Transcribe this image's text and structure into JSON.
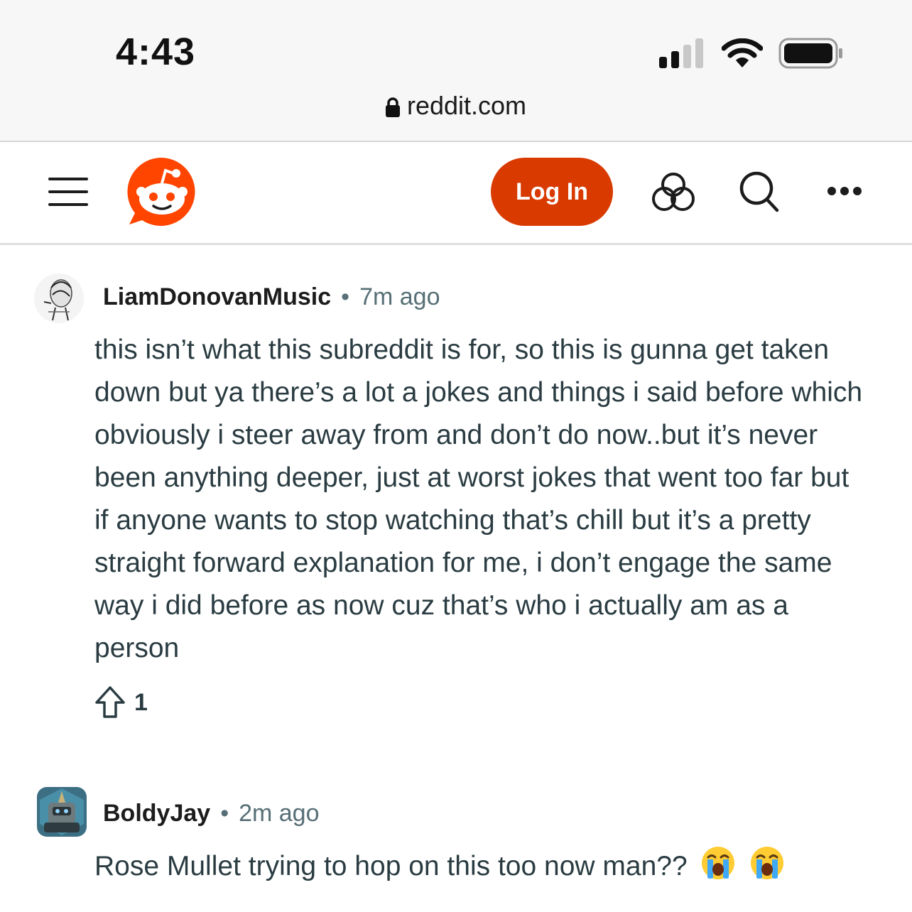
{
  "status_bar": {
    "time": "4:43"
  },
  "browser": {
    "url": "reddit.com"
  },
  "header": {
    "login_label": "Log In"
  },
  "comments": [
    {
      "username": "LiamDonovanMusic",
      "time": "7m ago",
      "body": "this isn’t what this subreddit is for, so this is gunna get taken down but ya there’s a lot a jokes and things i said before which obviously i steer away from and don’t do now..but it’s never been anything deeper, just at worst jokes that went too far but if anyone wants to stop watching that’s chill but it’s a pretty straight forward explanation for me, i don’t engage the same way i did before as now cuz that’s who i actually am as a person",
      "votes": "1"
    },
    {
      "username": "BoldyJay",
      "time": "2m ago",
      "body": "Rose Mullet trying to hop on this too now man??",
      "emojis": [
        "loudly-crying-face",
        "loudly-crying-face"
      ]
    }
  ],
  "colors": {
    "accent": "#d93a00",
    "reddit_orange": "#ff4500",
    "meta_gray": "#576f76"
  }
}
